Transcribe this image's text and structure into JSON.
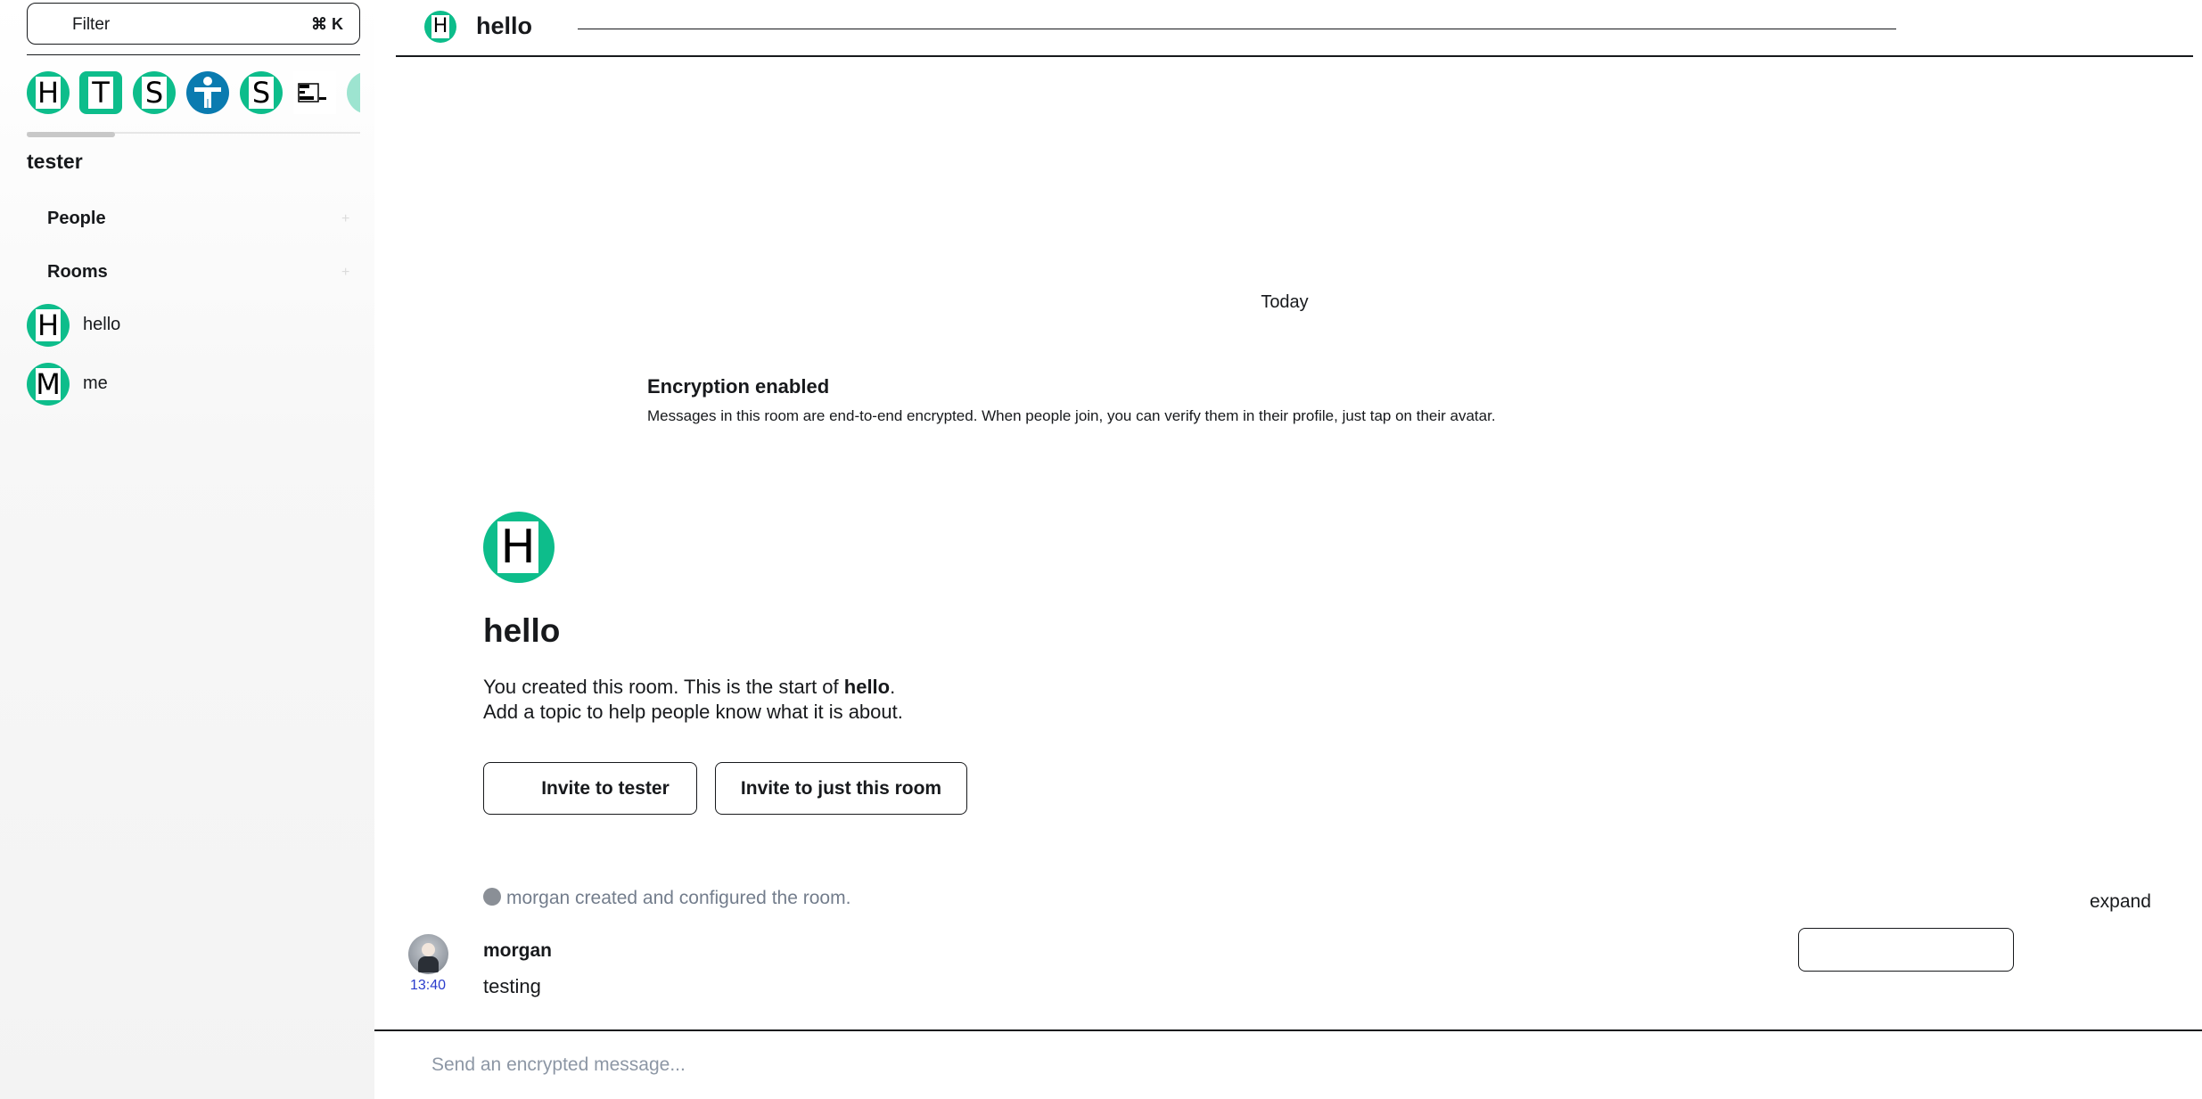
{
  "left_panel": {
    "filter": {
      "label": "Filter",
      "shortcut": "⌘ K"
    },
    "spaces": [
      {
        "letter": "H",
        "shape": "circle",
        "color": "#0dbd8b"
      },
      {
        "letter": "T",
        "shape": "square",
        "color": "#0dbd8b"
      },
      {
        "letter": "S",
        "shape": "circle",
        "color": "#0dbd8b"
      },
      {
        "letter": "",
        "shape": "circle",
        "color": "#0a7bb0",
        "icon": "accessibility-icon"
      },
      {
        "letter": "S",
        "shape": "circle",
        "color": "#0dbd8b"
      },
      {
        "letter": "",
        "shape": "square",
        "color": "#ffffff",
        "icon": "css-is-awesome-logo"
      }
    ],
    "space_name": "tester",
    "sections": {
      "people_label": "People",
      "rooms_label": "Rooms"
    },
    "rooms": [
      {
        "letter": "H",
        "name": "hello"
      },
      {
        "letter": "M",
        "name": "me"
      }
    ]
  },
  "room_header": {
    "avatar_letter": "H",
    "title": "hello"
  },
  "timeline": {
    "date_separator": "Today",
    "encryption": {
      "title": "Encryption enabled",
      "description": "Messages in this room are end-to-end encrypted. When people join, you can verify them in their profile, just tap on their avatar."
    },
    "intro": {
      "avatar_letter": "H",
      "title": "hello",
      "line1_prefix": "You created this room. This is the start of ",
      "line1_room": "hello",
      "line1_suffix": ".",
      "line2": "Add a topic to help people know what it is about.",
      "invite_space_button": "Invite to tester",
      "invite_room_button": "Invite to just this room"
    },
    "created_summary": "morgan created and configured the room.",
    "expand_label": "expand",
    "message": {
      "sender": "morgan",
      "time": "13:40",
      "body": "testing"
    }
  },
  "composer": {
    "placeholder": "Send an encrypted message..."
  },
  "colors": {
    "accent": "#0dbd8b",
    "timestamp": "#2a3ccc",
    "muted_text": "#737d8c"
  }
}
